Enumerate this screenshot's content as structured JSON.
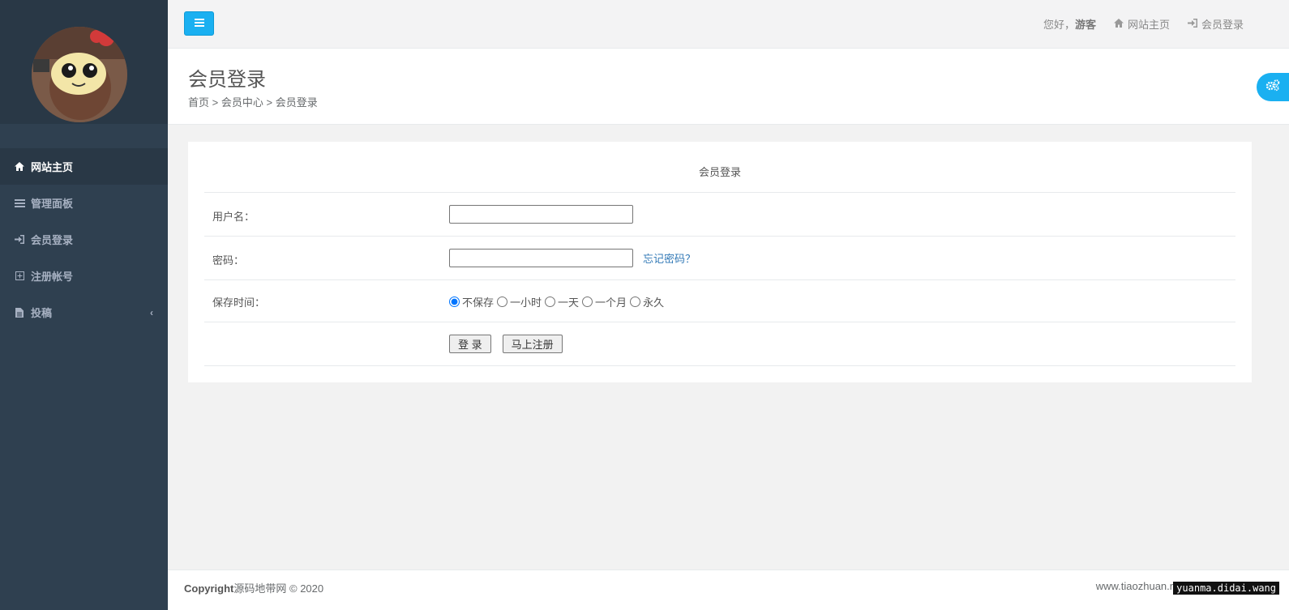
{
  "colors": {
    "accent": "#1ab0f1",
    "sidebar": "#2f4050",
    "sidebar_active": "#293846",
    "link": "#337ab7"
  },
  "sidebar": {
    "items": [
      {
        "label": "网站主页",
        "icon": "home-icon",
        "active": true
      },
      {
        "label": "管理面板",
        "icon": "list-icon",
        "active": false
      },
      {
        "label": "会员登录",
        "icon": "sign-in-icon",
        "active": false
      },
      {
        "label": "注册帐号",
        "icon": "plus-square-icon",
        "active": false
      },
      {
        "label": "投稿",
        "icon": "file-icon",
        "active": false
      }
    ]
  },
  "topbar": {
    "greeting": "您好，",
    "username": "游客",
    "home_link": "网站主页",
    "login_link": "会员登录"
  },
  "page": {
    "title": "会员登录",
    "breadcrumb": [
      "首页",
      "会员中心",
      "会员登录"
    ],
    "breadcrumb_sep": ">"
  },
  "form": {
    "title": "会员登录",
    "username_label": "用户名：",
    "username_value": "",
    "password_label": "密码：",
    "password_value": "",
    "forgot_link": "忘记密码？",
    "save_label": "保存时间：",
    "save_options": [
      "不保存",
      "一小时",
      "一天",
      "一个月",
      "永久"
    ],
    "save_selected": "不保存",
    "login_button": "登 录",
    "register_button": "马上注册"
  },
  "footer": {
    "copyright_bold": "Copyright",
    "copyright_rest": "源码地带网 © 2020",
    "site_url": "www.tiaozhuan.n",
    "watermark": "yuanma.didai.wang"
  }
}
